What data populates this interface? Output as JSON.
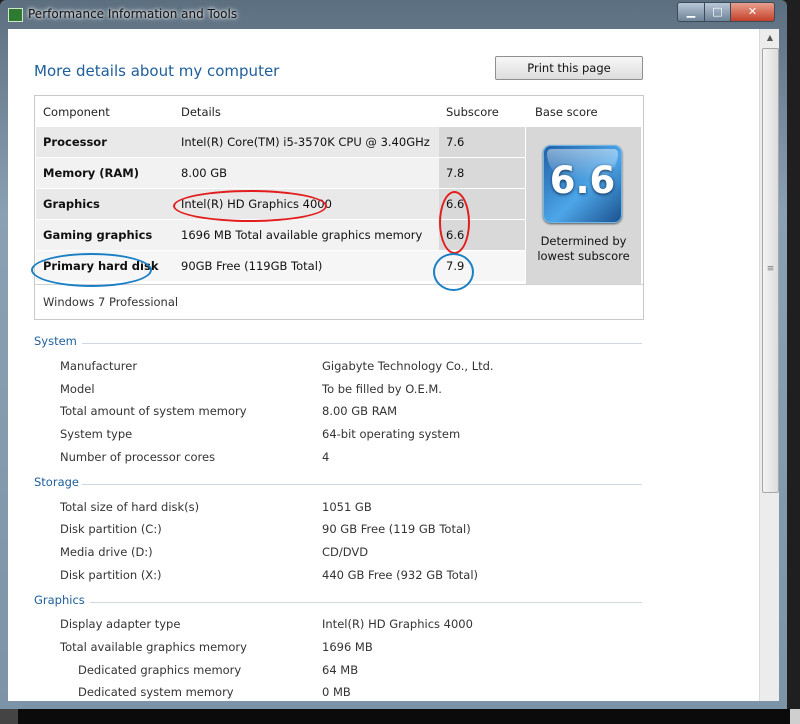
{
  "window": {
    "title": "Performance Information and Tools",
    "min": "▁",
    "max": "□",
    "close": "✕"
  },
  "header": {
    "heading": "More details about my computer",
    "print_label": "Print this page"
  },
  "score_table": {
    "headers": {
      "component": "Component",
      "details": "Details",
      "subscore": "Subscore",
      "base": "Base score"
    },
    "rows": [
      {
        "component": "Processor",
        "details": "Intel(R) Core(TM) i5-3570K CPU @ 3.40GHz",
        "subscore": "7.6"
      },
      {
        "component": "Memory (RAM)",
        "details": "8.00 GB",
        "subscore": "7.8"
      },
      {
        "component": "Graphics",
        "details": "Intel(R) HD Graphics 4000",
        "subscore": "6.6"
      },
      {
        "component": "Gaming graphics",
        "details": "1696 MB Total available graphics memory",
        "subscore": "6.6"
      },
      {
        "component": "Primary hard disk",
        "details": "90GB Free (119GB Total)",
        "subscore": "7.9"
      }
    ],
    "base_score": "6.6",
    "base_caption_1": "Determined by",
    "base_caption_2": "lowest subscore",
    "os": "Windows 7 Professional"
  },
  "system": {
    "title": "System",
    "props": [
      {
        "label": "Manufacturer",
        "value": "Gigabyte Technology Co., Ltd."
      },
      {
        "label": "Model",
        "value": "To be filled by O.E.M."
      },
      {
        "label": "Total amount of system memory",
        "value": "8.00 GB RAM"
      },
      {
        "label": "System type",
        "value": "64-bit operating system"
      },
      {
        "label": "Number of processor cores",
        "value": "4"
      }
    ]
  },
  "storage": {
    "title": "Storage",
    "props": [
      {
        "label": "Total size of hard disk(s)",
        "value": "1051 GB"
      },
      {
        "label": "Disk partition (C:)",
        "value": "90 GB Free (119 GB Total)"
      },
      {
        "label": "Media drive (D:)",
        "value": "CD/DVD"
      },
      {
        "label": "Disk partition (X:)",
        "value": "440 GB Free (932 GB Total)"
      }
    ]
  },
  "graphics": {
    "title": "Graphics",
    "props": [
      {
        "label": "Display adapter type",
        "value": "Intel(R) HD Graphics 4000"
      },
      {
        "label": "Total available graphics memory",
        "value": "1696 MB"
      },
      {
        "label": "Dedicated graphics memory",
        "value": "64 MB"
      },
      {
        "label": "Dedicated system memory",
        "value": "0 MB"
      }
    ]
  },
  "annotation_colors": {
    "red": "#e21d1d",
    "blue": "#1a7fc4"
  },
  "scrollbar": {
    "up": "▲",
    "grip": "≡"
  }
}
